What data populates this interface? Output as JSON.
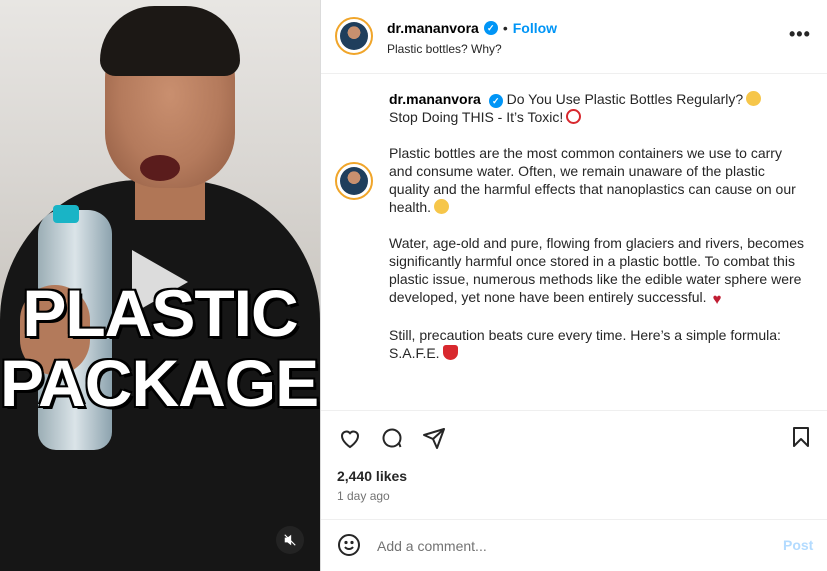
{
  "media": {
    "overlay_line1": "PLASTIC",
    "overlay_line2": "PACKAGED",
    "mute_icon": "speaker-muted-icon"
  },
  "header": {
    "username": "dr.mananvora",
    "separator": "•",
    "follow_label": "Follow",
    "subtitle": "Plastic bottles? Why?",
    "more_label": "•••"
  },
  "caption": {
    "username": "dr.mananvora",
    "headline": "Do You Use Plastic Bottles Regularly?",
    "line2": "Stop Doing THIS - It’s Toxic!",
    "p1": "Plastic bottles are the most common containers we use to carry and consume water. Often, we remain unaware of the plastic quality and the harmful effects that nanoplastics can cause on our health.",
    "p2": "Water, age-old and pure, flowing from glaciers and rivers, becomes significantly harmful once stored in a plastic bottle. To combat this plastic issue, numerous methods like the edible water sphere were developed, yet none have been entirely successful.",
    "p3": "Still, precaution beats cure every time. Here’s a simple formula: S.A.F.E."
  },
  "actions": {
    "likes": "2,440 likes",
    "time_ago": "1 day ago"
  },
  "comment": {
    "placeholder": "Add a comment...",
    "post_label": "Post"
  },
  "colors": {
    "accent": "#0095f6",
    "post_disabled": "#b3dbff",
    "avatar_ring": "#f0a52a"
  }
}
